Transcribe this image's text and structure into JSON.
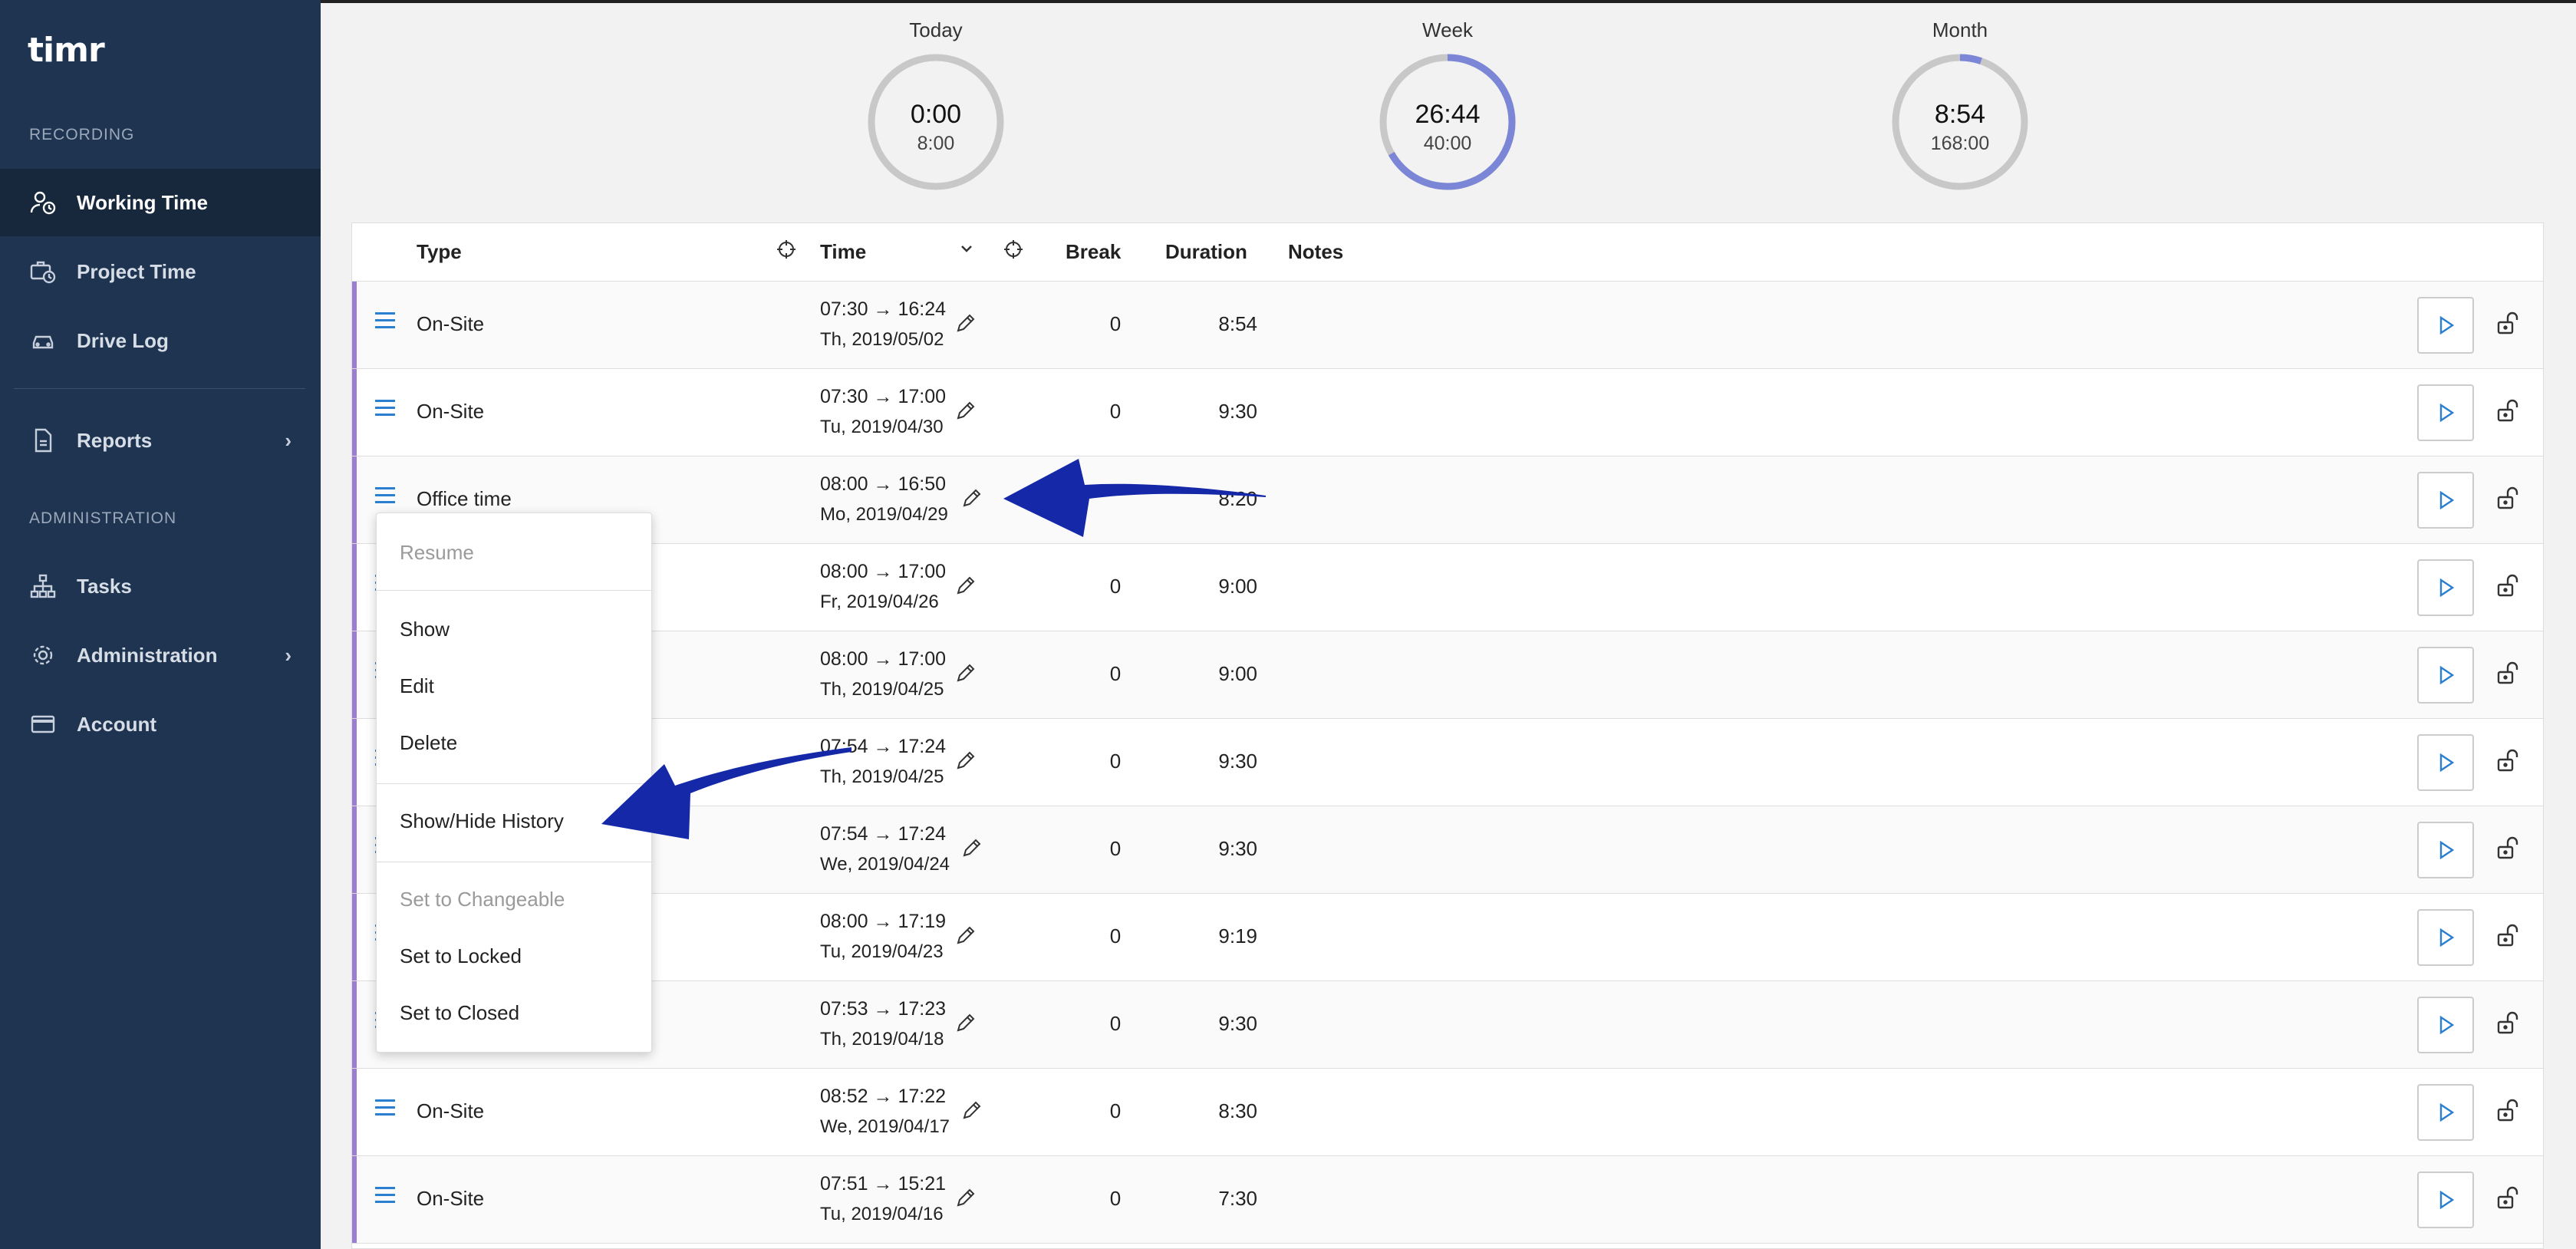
{
  "app": {
    "logo": "timr"
  },
  "sidebar": {
    "recording_label": "RECORDING",
    "admin_label": "ADMINISTRATION",
    "items": [
      {
        "label": "Working Time",
        "icon": "user-clock-icon"
      },
      {
        "label": "Project Time",
        "icon": "briefcase-clock-icon"
      },
      {
        "label": "Drive Log",
        "icon": "car-icon"
      },
      {
        "label": "Reports",
        "icon": "document-icon"
      },
      {
        "label": "Tasks",
        "icon": "sitemap-icon"
      },
      {
        "label": "Administration",
        "icon": "gear-icon"
      },
      {
        "label": "Account",
        "icon": "credit-card-icon"
      }
    ]
  },
  "gauges": [
    {
      "label": "Today",
      "value": "0:00",
      "target": "8:00",
      "progress": 0.0
    },
    {
      "label": "Week",
      "value": "26:44",
      "target": "40:00",
      "progress": 0.668
    },
    {
      "label": "Month",
      "value": "8:54",
      "target": "168:00",
      "progress": 0.053
    }
  ],
  "table": {
    "headers": {
      "type": "Type",
      "time": "Time",
      "break": "Break",
      "duration": "Duration",
      "notes": "Notes"
    },
    "rows": [
      {
        "type": "On-Site",
        "time": "07:30 → 16:24",
        "date": "Th, 2019/05/02",
        "break": "0",
        "duration": "8:54"
      },
      {
        "type": "On-Site",
        "time": "07:30 → 17:00",
        "date": "Tu, 2019/04/30",
        "break": "0",
        "duration": "9:30"
      },
      {
        "type": "Office time",
        "time": "08:00 → 16:50",
        "date": "Mo, 2019/04/29",
        "break": "",
        "duration": "8:20"
      },
      {
        "type": "",
        "time": "08:00 → 17:00",
        "date": "Fr, 2019/04/26",
        "break": "0",
        "duration": "9:00"
      },
      {
        "type": "",
        "time": "08:00 → 17:00",
        "date": "Th, 2019/04/25",
        "break": "0",
        "duration": "9:00"
      },
      {
        "type": "",
        "time": "07:54 → 17:24",
        "date": "Th, 2019/04/25",
        "break": "0",
        "duration": "9:30"
      },
      {
        "type": "",
        "time": "07:54 → 17:24",
        "date": "We, 2019/04/24",
        "break": "0",
        "duration": "9:30"
      },
      {
        "type": "",
        "time": "08:00 → 17:19",
        "date": "Tu, 2019/04/23",
        "break": "0",
        "duration": "9:19"
      },
      {
        "type": "",
        "time": "07:53 → 17:23",
        "date": "Th, 2019/04/18",
        "break": "0",
        "duration": "9:30"
      },
      {
        "type": "On-Site",
        "time": "08:52 → 17:22",
        "date": "We, 2019/04/17",
        "break": "0",
        "duration": "8:30"
      },
      {
        "type": "On-Site",
        "time": "07:51 → 15:21",
        "date": "Tu, 2019/04/16",
        "break": "0",
        "duration": "7:30"
      }
    ]
  },
  "context_menu": {
    "resume": "Resume",
    "show": "Show",
    "edit": "Edit",
    "delete": "Delete",
    "history": "Show/Hide History",
    "set_changeable": "Set to Changeable",
    "set_locked": "Set to Locked",
    "set_closed": "Set to Closed"
  },
  "colors": {
    "sidebar_bg": "#1e3450",
    "accent_purple": "#9b7dd4",
    "gauge_fill": "#7b86d6",
    "gauge_track": "#c8c8c8",
    "link_blue": "#2b7fd0",
    "annotation_arrow": "#1428a8"
  }
}
